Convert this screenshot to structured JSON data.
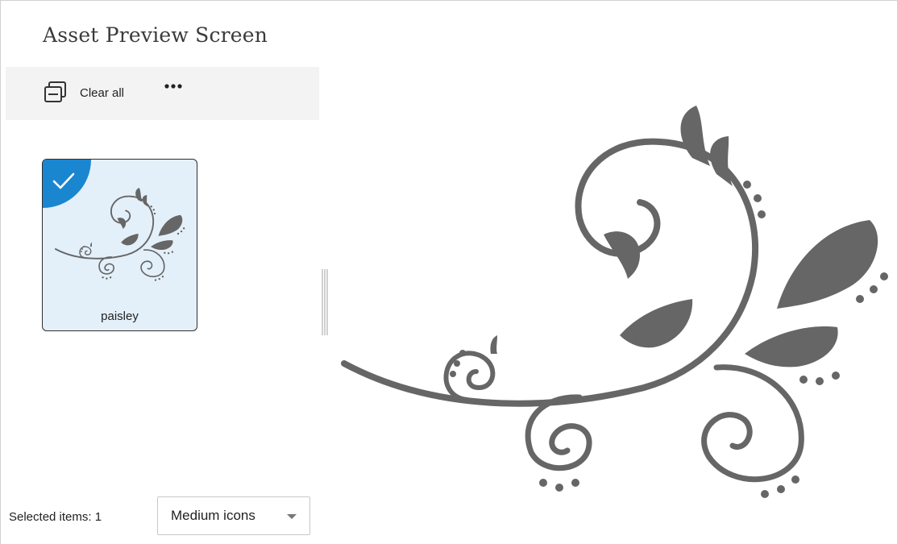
{
  "window": {
    "title": "Asset Preview Screen"
  },
  "toolbar": {
    "clear_all_label": "Clear all",
    "clear_all_icon": "stacked-pages-icon",
    "more_icon": "more-options-icon"
  },
  "gallery": {
    "items": [
      {
        "label": "paisley",
        "selected": true,
        "icon": "paisley-swirl-image"
      }
    ]
  },
  "footer": {
    "selected_text": "Selected items: 1",
    "view_mode": {
      "selected": "Medium icons"
    }
  },
  "colors": {
    "accent": "#1a86d0",
    "thumb_background": "#e3f0fa",
    "toolbar_background": "#f3f3f3",
    "artwork": "#666666"
  }
}
